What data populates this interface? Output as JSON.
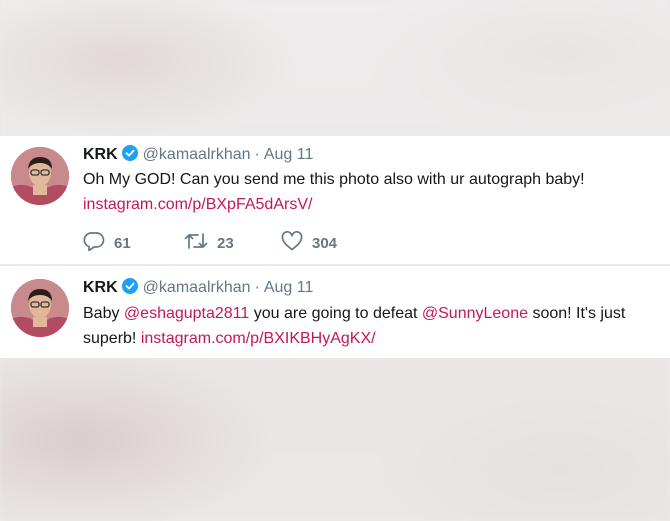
{
  "tweets": [
    {
      "display_name": "KRK",
      "handle": "@kamaalrkhan",
      "separator": "·",
      "date": "Aug 11",
      "text_parts": [
        {
          "type": "text",
          "value": "Oh My GOD! Can you send me this photo also with ur autograph baby!"
        },
        {
          "type": "link",
          "value": "instagram.com/p/BXpFA5dArsV/"
        }
      ],
      "actions": {
        "replies": "61",
        "retweets": "23",
        "likes": "304"
      }
    },
    {
      "display_name": "KRK",
      "handle": "@kamaalrkhan",
      "separator": "·",
      "date": "Aug 11",
      "text_parts": [
        {
          "type": "text",
          "value": "Baby "
        },
        {
          "type": "mention",
          "value": "@eshagupta2811"
        },
        {
          "type": "text",
          "value": " you are going to defeat "
        },
        {
          "type": "mention",
          "value": "@SunnyLeone"
        },
        {
          "type": "text",
          "value": " soon! It's just superb! "
        },
        {
          "type": "link",
          "value": "instagram.com/p/BXIKBHyAgKX/"
        }
      ]
    }
  ],
  "icons": {
    "verified": "verified-badge-icon",
    "reply": "reply-icon",
    "retweet": "retweet-icon",
    "like": "heart-icon"
  },
  "colors": {
    "link": "#c2185b",
    "verified": "#1da1f2",
    "meta": "#657786",
    "text": "#14171a"
  }
}
